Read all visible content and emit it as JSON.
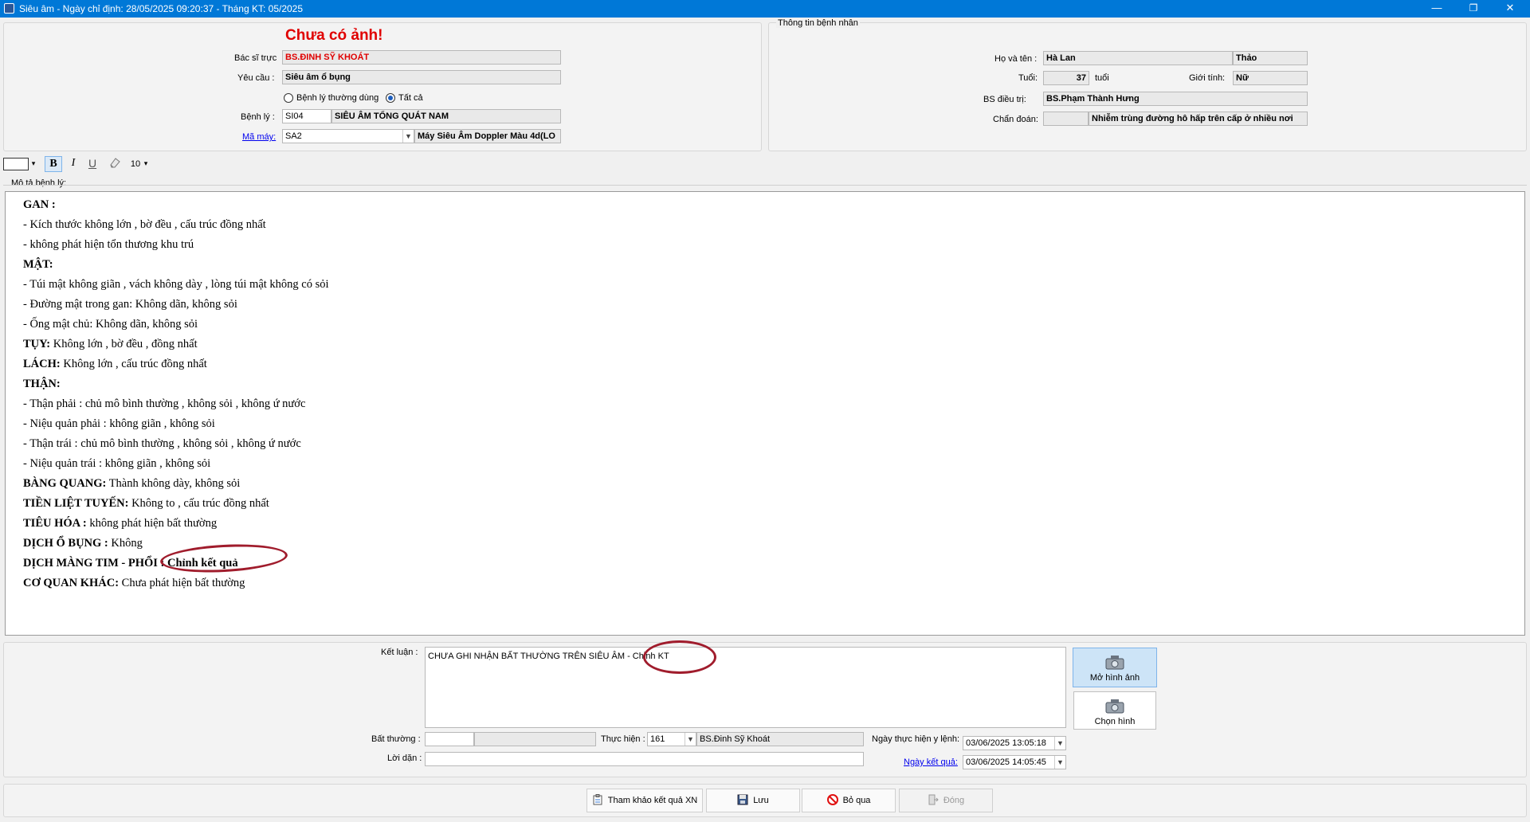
{
  "window": {
    "title": "Siêu âm - Ngày chỉ định: 28/05/2025 09:20:37 - Tháng KT: 05/2025",
    "minimize": "—",
    "restore": "❐",
    "close": "✕"
  },
  "top_left": {
    "no_image": "Chưa có ảnh!",
    "doctor_label": "Bác sĩ trực",
    "doctor_value": "BS.ĐINH SỸ KHOÁT",
    "request_label": "Yêu cầu :",
    "request_value": "Siêu âm ổ bụng",
    "radio_common": "Bệnh lý thường dùng",
    "radio_all": "Tất cả",
    "disease_label": "Bệnh lý :",
    "disease_code": "SI04",
    "disease_name": "SIÊU ÂM TỔNG QUÁT NAM",
    "machine_label": "Mã máy:",
    "machine_code": "SA2",
    "machine_name": "Máy Siêu Âm Doppler Màu 4d(LO"
  },
  "patient": {
    "group_title": "Thông tin bệnh nhân",
    "name_label": "Họ và tên :",
    "name_value": "Hà Lan",
    "first_name": "Thảo",
    "age_label": "Tuổi:",
    "age_value": "37",
    "age_unit": "tuổi",
    "gender_label": "Giới tính:",
    "gender_value": "Nữ",
    "treating_label": "BS điều trị:",
    "treating_value": "BS.Phạm Thành Hưng",
    "diagnosis_label": "Chẩn đoán:",
    "diagnosis_value": "Nhiễm trùng đường hô hấp trên cấp ở nhiều nơi"
  },
  "toolbar": {
    "bold": "B",
    "italic": "I",
    "underline": "U",
    "font_size": "10",
    "arrow": "▾"
  },
  "description_label": "Mô tả bệnh lý:",
  "report_lines": [
    {
      "b": "GAN :",
      "t": ""
    },
    {
      "b": "",
      "t": "- Kích thước không lớn , bờ đều , cấu trúc đồng nhất"
    },
    {
      "b": "",
      "t": "- không phát hiện tổn thương khu trú"
    },
    {
      "b": "MẬT:",
      "t": ""
    },
    {
      "b": "",
      "t": "- Túi mật không giãn , vách không dày , lòng túi mật không có sỏi"
    },
    {
      "b": "",
      "t": "- Đường mật trong gan: Không dãn, không sỏi"
    },
    {
      "b": "",
      "t": "- Ống mật chủ:  Không dãn, không sỏi"
    },
    {
      "b": "TỤY:",
      "t": " Không lớn , bờ đều , đồng nhất"
    },
    {
      "b": "LÁCH:",
      "t": "   Không lớn , cấu trúc đồng nhất"
    },
    {
      "b": "THẬN:",
      "t": ""
    },
    {
      "b": "",
      "t": "- Thận phải : chủ mô bình thường , không sỏi , không ứ nước"
    },
    {
      "b": "",
      "t": "- Niệu quản phải : không giãn , không sỏi"
    },
    {
      "b": "",
      "t": "- Thận trái : chủ mô bình thường , không sỏi , không ứ nước"
    },
    {
      "b": "",
      "t": "- Niệu quản trái : không giãn , không sỏi"
    },
    {
      "b": "BÀNG QUANG:",
      "t": " Thành không dày, không sỏi"
    },
    {
      "b": "TIỀN LIỆT TUYẾN:",
      "t": " Không to , cấu trúc đồng nhất"
    },
    {
      "b": "TIÊU HÓA :",
      "t": " không phát hiện bất thường"
    },
    {
      "b": "DỊCH Ổ BỤNG :",
      "t": " Không"
    },
    {
      "b": "DỊCH MÀNG TIM - PHỔI : Chỉnh kết quả",
      "t": ""
    },
    {
      "b": "CƠ QUAN KHÁC:",
      "t": " Chưa phát hiện bất thường"
    }
  ],
  "conclusion": {
    "label": "Kết luận :",
    "value": "CHƯA GHI NHẬN BẤT THƯỜNG TRÊN SIÊU ÂM - Chỉnh KT",
    "open_image": "Mở hình ảnh",
    "choose_image": "Chọn hình"
  },
  "bottom_fields": {
    "abnormal_label": "Bất thường :",
    "performer_label": "Thực hiện :",
    "performer_code": "161",
    "performer_name": "BS.Đinh Sỹ Khoát",
    "note_label": "Lời dặn :",
    "order_date_label": "Ngày thực hiện y lệnh:",
    "order_date_value": "03/06/2025 13:05:18",
    "result_date_label": "Ngày kết quả:",
    "result_date_value": "03/06/2025 14:05:45"
  },
  "buttons": {
    "reference": "Tham khảo kết quả XN",
    "save": "Lưu",
    "cancel": "Bỏ qua",
    "close": "Đóng"
  },
  "colors": {
    "titlebar": "#0078d7",
    "alert_red": "#e00000",
    "annotation": "#a01c2c"
  }
}
